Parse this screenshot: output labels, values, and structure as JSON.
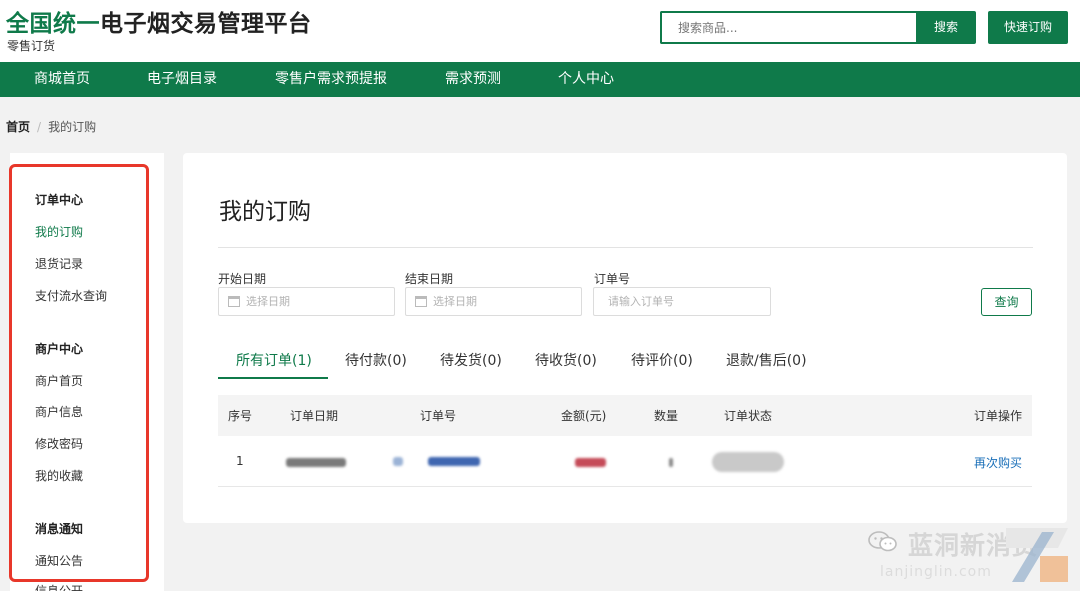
{
  "header": {
    "title_accent": "全国统一",
    "title_rest": "电子烟交易管理平台",
    "subtitle": "零售订货",
    "search_placeholder": "搜索商品...",
    "search_button": "搜索",
    "quick_order_button": "快速订购"
  },
  "nav": {
    "items": [
      {
        "label": "商城首页"
      },
      {
        "label": "电子烟目录"
      },
      {
        "label": "零售户需求预提报"
      },
      {
        "label": "需求预测"
      },
      {
        "label": "个人中心"
      }
    ]
  },
  "breadcrumb": {
    "home": "首页",
    "separator": "/",
    "current": "我的订购"
  },
  "sidebar": {
    "groups": [
      {
        "title": "订单中心",
        "items": [
          {
            "label": "我的订购",
            "active": true
          },
          {
            "label": "退货记录"
          },
          {
            "label": "支付流水查询"
          }
        ]
      },
      {
        "title": "商户中心",
        "items": [
          {
            "label": "商户首页"
          },
          {
            "label": "商户信息"
          },
          {
            "label": "修改密码"
          },
          {
            "label": "我的收藏"
          }
        ]
      },
      {
        "title": "消息通知",
        "items": [
          {
            "label": "通知公告"
          },
          {
            "label": "信息公开"
          }
        ]
      }
    ]
  },
  "main": {
    "title": "我的订购",
    "filters": {
      "start_date_label": "开始日期",
      "start_date_placeholder": "选择日期",
      "end_date_label": "结束日期",
      "end_date_placeholder": "选择日期",
      "order_no_label": "订单号",
      "order_no_placeholder": "请输入订单号",
      "query_button": "查询"
    },
    "tabs": [
      {
        "label": "所有订单(1)",
        "active": true
      },
      {
        "label": "待付款(0)"
      },
      {
        "label": "待发货(0)"
      },
      {
        "label": "待收货(0)"
      },
      {
        "label": "待评价(0)"
      },
      {
        "label": "退款/售后(0)"
      }
    ],
    "table": {
      "columns": [
        "序号",
        "订单日期",
        "订单号",
        "金额(元)",
        "数量",
        "订单状态",
        "订单操作"
      ],
      "rows": [
        {
          "index": "1",
          "action": "再次购买"
        }
      ]
    }
  },
  "watermark": {
    "name": "蓝洞新消费",
    "url": "lanjinglin.com"
  },
  "colors": {
    "brand_green": "#0f7a4a",
    "highlight_red": "#e8372a",
    "link_blue": "#1a6fb8"
  },
  "icons": {
    "calendar": "calendar-icon",
    "wechat": "wechat-icon"
  }
}
